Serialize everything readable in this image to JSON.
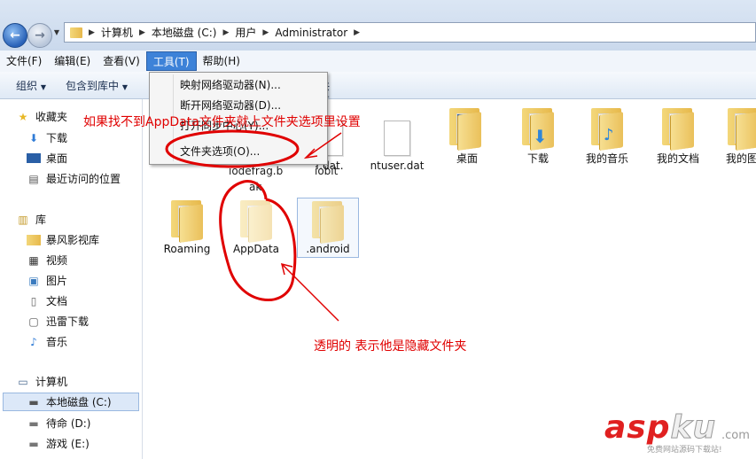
{
  "address": {
    "crumbs": [
      "计算机",
      "本地磁盘 (C:)",
      "用户",
      "Administrator"
    ]
  },
  "menubar": {
    "items": [
      {
        "label": "文件(F)"
      },
      {
        "label": "编辑(E)"
      },
      {
        "label": "查看(V)"
      },
      {
        "label": "工具(T)"
      },
      {
        "label": "帮助(H)"
      }
    ]
  },
  "toolbar": {
    "organize_label": "组织",
    "include_label": "包含到库中",
    "partial_label": "共享"
  },
  "tools_menu": {
    "items": [
      {
        "label": "映射网络驱动器(N)..."
      },
      {
        "label": "断开网络驱动器(D)..."
      },
      {
        "label": "打开同步中心(Y)..."
      },
      {
        "label": "文件夹选项(O)..."
      }
    ]
  },
  "sidebar": {
    "favorites": {
      "header": "收藏夹",
      "items": [
        {
          "label": "下载"
        },
        {
          "label": "桌面"
        },
        {
          "label": "最近访问的位置"
        }
      ]
    },
    "libraries": {
      "header": "库",
      "items": [
        {
          "label": "暴风影视库"
        },
        {
          "label": "视频"
        },
        {
          "label": "图片"
        },
        {
          "label": "文档"
        },
        {
          "label": "迅雷下载"
        },
        {
          "label": "音乐"
        }
      ]
    },
    "computer": {
      "header": "计算机",
      "items": [
        {
          "label": "本地磁盘 (C:)"
        },
        {
          "label": "待命 (D:)"
        },
        {
          "label": "游戏 (E:)"
        }
      ]
    }
  },
  "files": {
    "row1": [
      {
        "label": "r.dat."
      },
      {
        "label": "ntuser.dat"
      },
      {
        "label": "桌面"
      },
      {
        "label": "下载"
      },
      {
        "label": "我的音乐"
      },
      {
        "label": "我的文档"
      },
      {
        "label": "我的图"
      }
    ],
    "row1_sub": [
      "iodefrag.b",
      "ak",
      "iobit"
    ],
    "row2": [
      {
        "label": "Roaming"
      },
      {
        "label": "AppData"
      },
      {
        "label": ".android"
      }
    ]
  },
  "annotations": {
    "top_note": "如果找不到AppData文件夹就上文件夹选项里设置",
    "bottom_note": "透明的  表示他是隐藏文件夹"
  },
  "watermark": {
    "brand_a": "asp",
    "brand_b": "ku",
    "tld": ".com",
    "sub": "免费网站源码下载站!"
  }
}
